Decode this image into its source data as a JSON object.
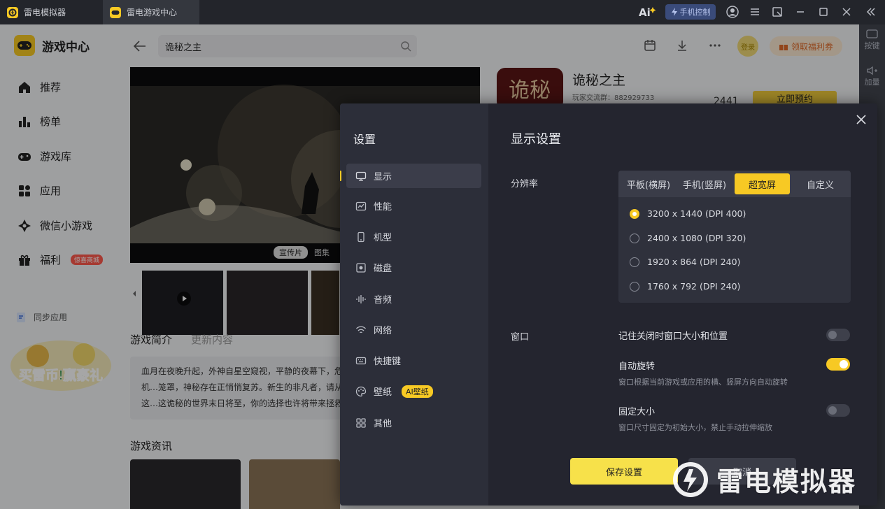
{
  "window": {
    "tabs": [
      {
        "label": "雷电模拟器"
      },
      {
        "label": "雷电游戏中心"
      }
    ],
    "phone_control_label": "手机控制"
  },
  "right_rail": {
    "items": [
      {
        "label": "按键"
      },
      {
        "label": "加量"
      }
    ]
  },
  "sidebar": {
    "title": "游戏中心",
    "items": [
      {
        "label": "推荐"
      },
      {
        "label": "榜单"
      },
      {
        "label": "游戏库"
      },
      {
        "label": "应用"
      },
      {
        "label": "微信小游戏"
      },
      {
        "label": "福利",
        "badge": "惊喜商城"
      }
    ],
    "sync_label": "同步应用",
    "promo_text": "买雷币!赢豪礼"
  },
  "main": {
    "search_value": "诡秘之主",
    "login_label": "登录",
    "welfare_label": "领取福利券",
    "banner_tags": [
      "宣传片",
      "图集"
    ],
    "game": {
      "name": "诡秘之主",
      "qq_group": "玩家交流群：882929733",
      "count": "2441",
      "reserve_label": "立即预约"
    },
    "tabs": [
      "游戏简介",
      "更新内容"
    ],
    "intro": "血月在夜晚升起，外神自星空窥视，平静的夜幕下，危机…笼罩，神秘存在正悄悄复苏。新生的非凡者，请从这…这诡秘的世界末日将至，你的选择也许将带来拯救…",
    "news_title": "游戏资讯"
  },
  "settings": {
    "title": "设置",
    "menu": [
      {
        "label": "显示",
        "icon": "monitor-icon"
      },
      {
        "label": "性能",
        "icon": "performance-icon"
      },
      {
        "label": "机型",
        "icon": "phone-icon"
      },
      {
        "label": "磁盘",
        "icon": "disk-icon"
      },
      {
        "label": "音频",
        "icon": "audio-icon"
      },
      {
        "label": "网络",
        "icon": "wifi-icon"
      },
      {
        "label": "快捷键",
        "icon": "keyboard-icon"
      },
      {
        "label": "壁纸",
        "icon": "palette-icon",
        "badge": "AI壁纸"
      },
      {
        "label": "其他",
        "icon": "grid-icon"
      }
    ],
    "display": {
      "title": "显示设置",
      "resolution_label": "分辨率",
      "segments": [
        {
          "label": "平板(横屏)",
          "active": false
        },
        {
          "label": "手机(竖屏)",
          "active": false
        },
        {
          "label": "超宽屏",
          "active": true
        },
        {
          "label": "自定义",
          "active": false
        }
      ],
      "resolutions": [
        {
          "label": "3200 x 1440  (DPI 400)",
          "selected": true
        },
        {
          "label": "2400 x 1080  (DPI 320)",
          "selected": false
        },
        {
          "label": "1920 x 864  (DPI 240)",
          "selected": false
        },
        {
          "label": "1760 x 792  (DPI 240)",
          "selected": false
        }
      ],
      "window_label": "窗口",
      "options": [
        {
          "label": "记住关闭时窗口大小和位置",
          "desc": "",
          "on": false
        },
        {
          "label": "自动旋转",
          "desc": "窗口根据当前游戏或应用的横、竖屏方向自动旋转",
          "on": true
        },
        {
          "label": "固定大小",
          "desc": "窗口尺寸固定为初始大小，禁止手动拉伸缩放",
          "on": false
        }
      ],
      "save_label": "保存设置",
      "cancel_label": "取消"
    }
  },
  "watermark": "雷电模拟器",
  "colors": {
    "accent": "#f7c924",
    "modal_bg": "#24252f",
    "modal_sidebar": "#2c2e39"
  }
}
